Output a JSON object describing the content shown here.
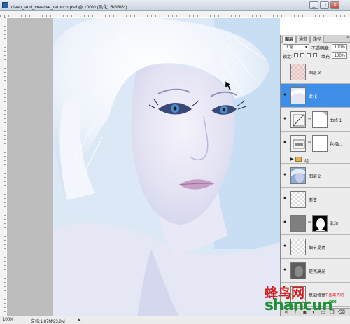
{
  "window": {
    "title": "clean_and_creative_retouch.psd @ 100% (柔化, RGB/8*)",
    "minimize": "_",
    "maximize": "□",
    "close": "×"
  },
  "status_bar": {
    "zoom": "100%",
    "doc_info": "文档:1.87M/23.8M",
    "arrow": "▸"
  },
  "layers_panel": {
    "tabs": [
      "图层",
      "通道",
      "路径"
    ],
    "active_tab": 0,
    "close": "×",
    "blend_mode": "正常",
    "opacity_label": "不透明度:",
    "opacity": "100%",
    "lock_label": "锁定:",
    "fill_label": "填充:",
    "fill": "100%",
    "layers": [
      {
        "name": "图层 3",
        "visible": false,
        "selected": false,
        "kind": "checker-red"
      },
      {
        "name": "柔化",
        "visible": true,
        "selected": true,
        "kind": "photo"
      },
      {
        "name": "曲线 1",
        "visible": true,
        "selected": false,
        "kind": "curves"
      },
      {
        "name": "色相/...",
        "visible": true,
        "selected": false,
        "kind": "hue"
      },
      {
        "name": "组 1",
        "visible": false,
        "selected": false,
        "kind": "group"
      },
      {
        "name": "图层 2",
        "visible": true,
        "selected": false,
        "kind": "photo-blue"
      },
      {
        "name": "渐变",
        "visible": true,
        "selected": false,
        "kind": "checker"
      },
      {
        "name": "柔和",
        "visible": true,
        "selected": false,
        "kind": "gray-mask"
      },
      {
        "name": "细节提亮",
        "visible": true,
        "selected": false,
        "kind": "checker"
      },
      {
        "name": "提亮高光",
        "visible": true,
        "selected": false,
        "kind": "dark"
      },
      {
        "name": "基础修复",
        "visible": true,
        "selected": false,
        "kind": "checker"
      }
    ],
    "bottom_icons": [
      "link-icon",
      "fx-icon",
      "mask-icon",
      "adjustment-icon",
      "folder-icon",
      "new-layer-icon",
      "trash-icon"
    ]
  },
  "watermark": {
    "chinese": "蜂鸟网",
    "latin": "shancun",
    "domain": ".net",
    "sub": "中国最大的"
  },
  "colors": {
    "selected": "#3f8ee8",
    "watermark_red": "#cf1f1f",
    "watermark_green": "#1f8f3a"
  }
}
